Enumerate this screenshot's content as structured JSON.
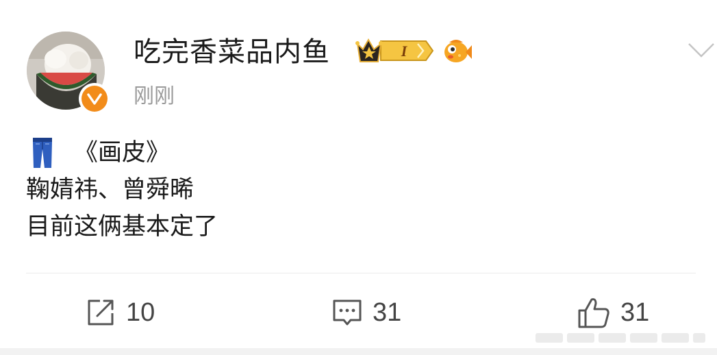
{
  "post": {
    "author": {
      "name": "吃完香菜品内鱼",
      "level_badge": "I",
      "time": "刚刚"
    },
    "content": {
      "lines": [
        "《画皮》",
        "鞠婧祎、曾舜晞",
        "目前这俩基本定了"
      ]
    },
    "actions": {
      "share_count": "10",
      "comment_count": "31",
      "like_count": "31"
    }
  },
  "colors": {
    "verified": "#f28c1a",
    "badge_gold": "#f5c542",
    "text": "#1a1a1a",
    "muted": "#9a9a9a"
  },
  "icons": [
    "jeans-icon",
    "share-icon",
    "comment-icon",
    "like-icon",
    "chevron-down-icon",
    "crown-icon",
    "fish-icon",
    "verified-icon"
  ]
}
